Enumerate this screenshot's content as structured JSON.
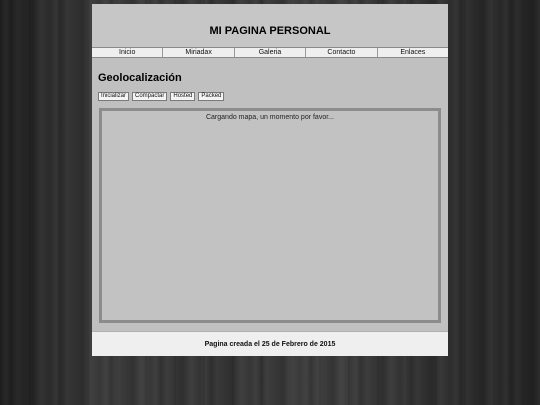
{
  "header": {
    "title": "MI PAGINA PERSONAL"
  },
  "nav": {
    "items": [
      {
        "label": "Inicio"
      },
      {
        "label": "Miriadax"
      },
      {
        "label": "Galeria"
      },
      {
        "label": "Contacto"
      },
      {
        "label": "Enlaces"
      }
    ]
  },
  "main": {
    "title": "Geolocalización",
    "buttons": [
      {
        "label": "Inicializar"
      },
      {
        "label": "Compactar"
      },
      {
        "label": "Hosted"
      },
      {
        "label": "Packed"
      }
    ],
    "map": {
      "loading_text": "Cargando mapa, un momento por favor..."
    }
  },
  "footer": {
    "text": "Pagina creada el 25 de Febrero de 2015"
  }
}
